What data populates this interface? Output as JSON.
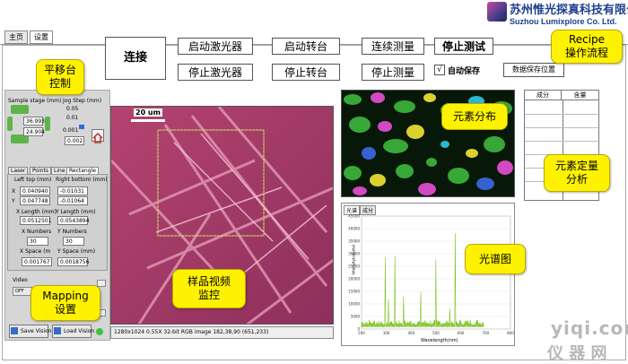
{
  "company": {
    "name_cn": "苏州惟光探真科技有限公司",
    "name_en": "Suzhou Lumixplore Co. Ltd."
  },
  "tabs": [
    {
      "label": "主页"
    },
    {
      "label": "设置"
    }
  ],
  "controls": {
    "connect": "连接",
    "start_laser": "启动激光器",
    "stop_laser": "停止激光器",
    "start_stage": "启动转台",
    "stop_stage": "停止转台",
    "continuous_measure": "连续测量",
    "stop_measure": "停止测量",
    "stop_test": "停止测试",
    "auto_save_check": "√",
    "auto_save": "自动保存",
    "data_save_location": "数据保存位置"
  },
  "callouts": {
    "stage": "平移台\n控制",
    "mapping": "Mapping\n设置",
    "video": "样品视频\n监控",
    "recipe": "Recipe\n操作流程",
    "element_map": "元素分布",
    "element_quant": "元素定量\n分析",
    "spectrum": "光谱图"
  },
  "stage": {
    "title": "Sample stage (mm)",
    "jog_title": "Jog Step (mm)",
    "x": "36.993",
    "y": "24.904",
    "jog_values": [
      "0.05",
      "0.01",
      "0.001"
    ],
    "jog_current": "0.002"
  },
  "mapping": {
    "tabs": [
      "Laser",
      "Points",
      "Line",
      "Rectangle"
    ],
    "left_top_label": "Left top (mm)",
    "right_bottom_label": "Right bottom (mm)",
    "x_label": "X",
    "y_label": "Y",
    "left_top_x": "0.040940",
    "left_top_y": "0.047748",
    "right_bottom_x": "-0.01031",
    "right_bottom_y": "-0.01064",
    "x_length_label": "X Length (mm)",
    "y_length_label": "Y Length (mm)",
    "x_length": "0.0512501",
    "y_length": "0.0543894",
    "x_numbers_label": "X Numbers",
    "y_numbers_label": "Y Numbers",
    "x_numbers": "30",
    "y_numbers": "30",
    "x_space_label": "X Space (m",
    "y_space_label": "Y Space (mm)",
    "x_space": "0.001767",
    "y_space": "0.0018756",
    "video_label": "Video",
    "off_label": "OFF",
    "save_vision": "Save Vision",
    "load_vision": "Load Vision"
  },
  "video": {
    "scale": "20 um",
    "status": "1280x1024 0.55X 32-bit RGB image 182,38,90    (651,233)"
  },
  "quant_table": {
    "headers": [
      "成分",
      "含量"
    ]
  },
  "spectrum": {
    "tabs": [
      "光谱",
      "成分"
    ],
    "y_ticks": [
      "45000",
      "40000",
      "35000",
      "30000",
      "25000",
      "20000",
      "15000",
      "10000",
      "5000",
      "0"
    ],
    "x_ticks": [
      "200",
      "300",
      "400",
      "500",
      "600",
      "700",
      "800"
    ],
    "xlabel": "Wavelength(nm)",
    "ylabel": "Intensity(counts)"
  },
  "watermark": {
    "line1": "yiqi.com",
    "line2": "仪 器 网"
  },
  "colors": {
    "callout": "#fff200",
    "title": "#1d3f8f",
    "video_bg": "#a33c6a",
    "spectrum_line": "#7dc022"
  }
}
